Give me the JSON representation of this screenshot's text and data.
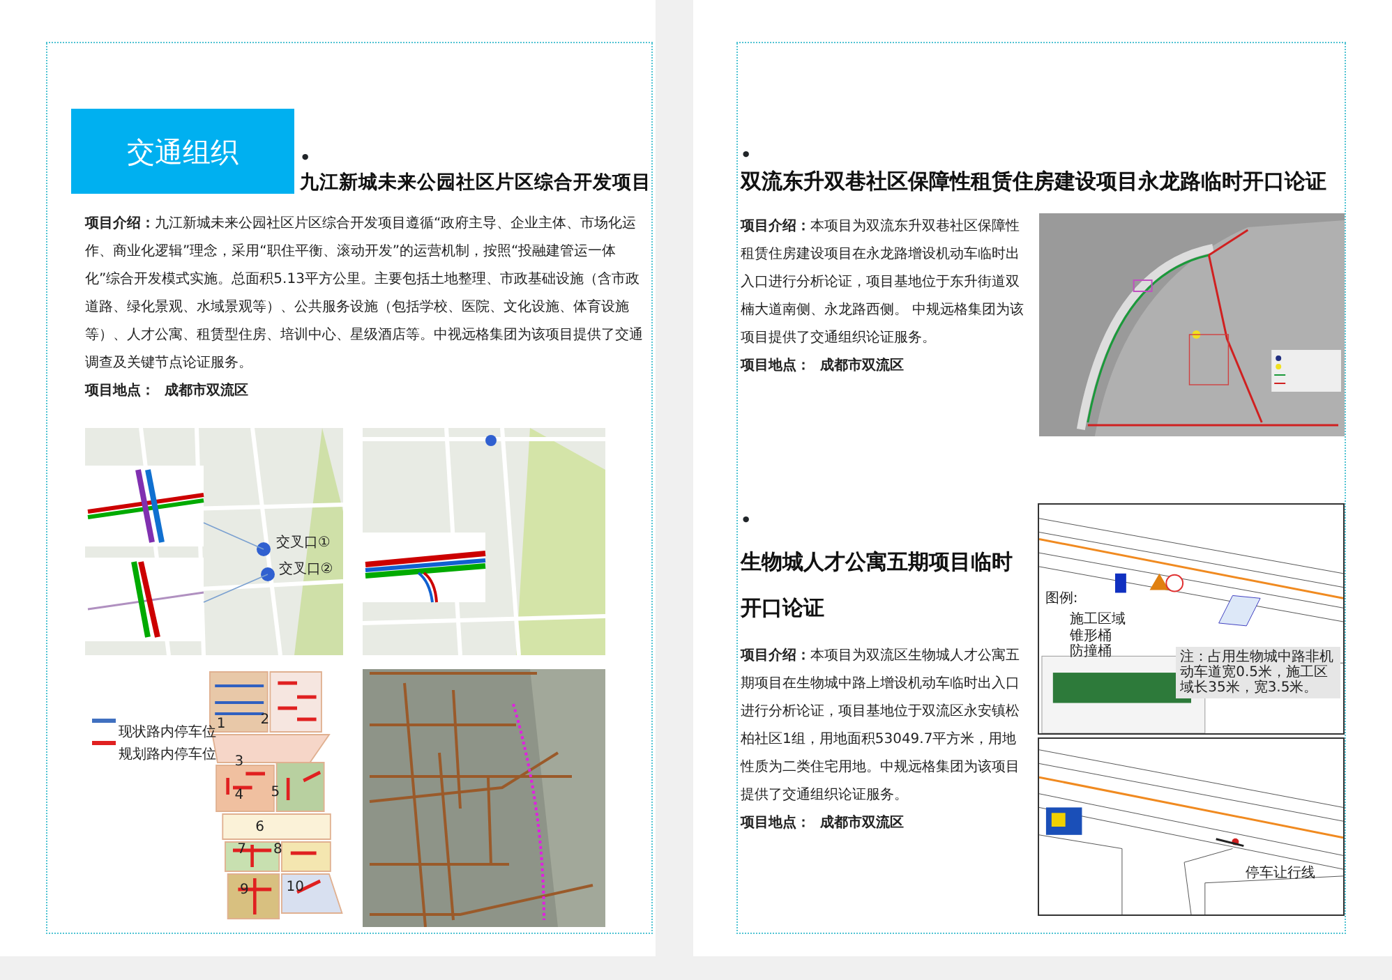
{
  "left_page": {
    "section_tag": "交通组织",
    "projects": [
      {
        "bullet": "•",
        "title": "九江新城未来公园社区片区综合开发项目",
        "intro_label": "项目介绍：",
        "intro": "九江新城未来公园社区片区综合开发项目遵循“政府主导、企业主体、市场化运作、商业化逻辑”理念，采用“职住平衡、滚动开发”的运营机制，按照“投融建管运一体化”综合开发模式实施。总面积5.13平方公里。主要包括土地整理、市政基础设施（含市政道路、绿化景观、水域景观等）、公共服务设施（包括学校、医院、文化设施、体育设施等）、人才公寓、租赁型住房、培训中心、星级酒店等。中视远格集团为该项目提供了交通调查及关键节点论证服务。",
        "location_label": "项目地点：",
        "location": "成都市双流区"
      }
    ],
    "figures": [
      {
        "kind": "junctions",
        "labels": [
          "交叉口①",
          "交叉口②"
        ]
      },
      {
        "kind": "corridor"
      },
      {
        "kind": "parking",
        "labels": [
          "现状路内停车位",
          "规划路内停车位",
          "1",
          "2",
          "3",
          "4",
          "5",
          "6",
          "7",
          "8",
          "9",
          "10"
        ]
      },
      {
        "kind": "aerial"
      }
    ]
  },
  "right_page": {
    "projects": [
      {
        "bullet": "•",
        "title": "双流东升双巷社区保障性租赁住房建设项目永龙路临时开口论证",
        "intro_label": "项目介绍：",
        "intro": "本项目为双流东升双巷社区保障性租赁住房建设项目在永龙路增设机动车临时出入口进行分析论证，项目基地位于东升街道双楠大道南侧、永龙路西侧。 中规远格集团为该项目提供了交通组织论证服务。",
        "location_label": "项目地点：",
        "location": "成都市双流区",
        "figures": [
          {
            "kind": "routes"
          }
        ]
      },
      {
        "bullet": "•",
        "title": "生物城人才公寓五期项目临时开口论证",
        "intro_label": "项目介绍：",
        "intro": "本项目为双流区生物城人才公寓五期项目在生物城中路上增设机动车临时出入口进行分析论证，项目基地位于双流区永安镇松柏社区1组，用地面积53049.7平方米，用地性质为二类住宅用地。中规远格集团为该项目提供了交通组织论证服务。",
        "location_label": "项目地点：",
        "location": "成都市双流区",
        "figures": [
          {
            "kind": "worksite",
            "labels": [
              "图例:",
              "施工区域",
              "锥形桶",
              "防撞桶",
              "注：占用生物城中路非机动车道宽0.5米，施工区域长35米，宽3.5米。"
            ]
          },
          {
            "kind": "entrance",
            "labels": [
              "停车让行线"
            ]
          }
        ]
      }
    ]
  }
}
